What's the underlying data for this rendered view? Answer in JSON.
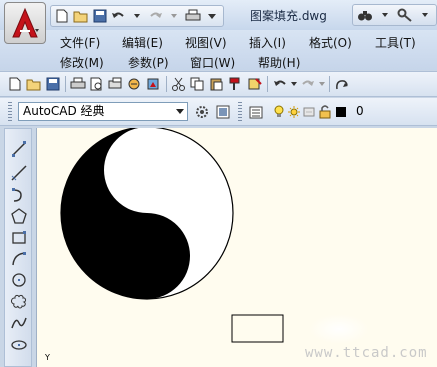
{
  "title_bar": {
    "document_title": "图案填充.dwg",
    "app_menu_icon": "autocad-logo-icon",
    "quick_access": [
      "new-icon",
      "open-icon",
      "save-icon",
      "undo-icon",
      "redo-icon",
      "plot-icon",
      "dropdown-icon"
    ],
    "search_icons": [
      "binoculars-icon",
      "key-icon"
    ]
  },
  "menubar": {
    "items": [
      {
        "label": "文件(F)"
      },
      {
        "label": "编辑(E)"
      },
      {
        "label": "视图(V)"
      },
      {
        "label": "插入(I)"
      },
      {
        "label": "格式(O)"
      },
      {
        "label": "工具(T)"
      },
      {
        "label": "修改(M)"
      },
      {
        "label": "参数(P)"
      },
      {
        "label": "窗口(W)"
      },
      {
        "label": "帮助(H)"
      }
    ]
  },
  "standard_toolbar": {
    "icons": [
      "new-icon",
      "open-icon",
      "save-icon",
      "plot-icon",
      "plot-preview-icon",
      "publish-icon",
      "3d-print-icon",
      "cut-icon",
      "copy-icon",
      "paste-icon",
      "match-properties-icon",
      "block-editor-icon",
      "undo-icon",
      "redo-icon",
      "pan-icon"
    ]
  },
  "workspace_toolbar": {
    "workspace_value": "AutoCAD 经典",
    "icons": [
      "workspace-settings-icon",
      "customize-icon",
      "layer-manager-icon",
      "lightbulb-icon",
      "sun-icon",
      "layer-freeze-icon",
      "lock-icon",
      "color-swatch-icon"
    ],
    "layer_value": "0",
    "layer_color": "#000000"
  },
  "draw_toolbar": {
    "icons": [
      "line-icon",
      "construction-line-icon",
      "polyline-icon",
      "polygon-icon",
      "rectangle-icon",
      "arc-icon",
      "circle-icon",
      "revision-cloud-icon",
      "spline-icon",
      "ellipse-icon"
    ]
  },
  "canvas": {
    "background": "#fffcef",
    "y_axis_label": "Y",
    "watermark": "www.ttcad.com"
  }
}
